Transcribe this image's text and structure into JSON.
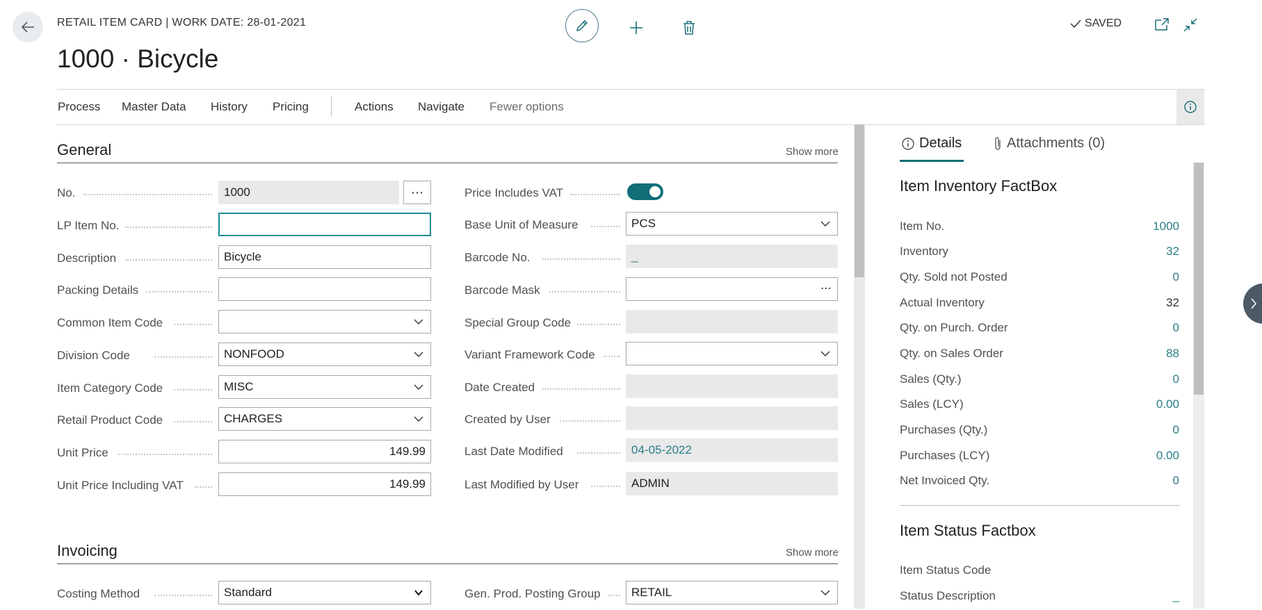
{
  "header": {
    "caption": "RETAIL ITEM CARD | WORK DATE: 28-01-2021",
    "title": "1000 · Bicycle",
    "status": "SAVED"
  },
  "actions": {
    "items": [
      "Process",
      "Master Data",
      "History",
      "Pricing",
      "Actions",
      "Navigate"
    ],
    "fewer_options": "Fewer options"
  },
  "general": {
    "title": "General",
    "show_more": "Show more",
    "left": [
      {
        "label": "No.",
        "value": "1000"
      },
      {
        "label": "LP Item No.",
        "value": ""
      },
      {
        "label": "Description",
        "value": "Bicycle"
      },
      {
        "label": "Packing Details",
        "value": ""
      },
      {
        "label": "Common Item Code",
        "value": ""
      },
      {
        "label": "Division Code",
        "value": "NONFOOD"
      },
      {
        "label": "Item Category Code",
        "value": "MISC"
      },
      {
        "label": "Retail Product Code",
        "value": "CHARGES"
      },
      {
        "label": "Unit Price",
        "value": "149.99"
      },
      {
        "label": "Unit Price Including VAT",
        "value": "149.99"
      }
    ],
    "right": [
      {
        "label": "Price Includes VAT",
        "value": "on"
      },
      {
        "label": "Base Unit of Measure",
        "value": "PCS"
      },
      {
        "label": "Barcode No.",
        "value": "_"
      },
      {
        "label": "Barcode Mask",
        "value": ""
      },
      {
        "label": "Special Group Code",
        "value": ""
      },
      {
        "label": "Variant Framework Code",
        "value": ""
      },
      {
        "label": "Date Created",
        "value": ""
      },
      {
        "label": "Created by User",
        "value": ""
      },
      {
        "label": "Last Date Modified",
        "value": "04-05-2022"
      },
      {
        "label": "Last Modified by User",
        "value": "ADMIN"
      }
    ]
  },
  "invoicing": {
    "title": "Invoicing",
    "show_more": "Show more",
    "costing_method_label": "Costing Method",
    "costing_method_value": "Standard",
    "gen_prod_label": "Gen. Prod. Posting Group",
    "gen_prod_value": "RETAIL"
  },
  "factbox": {
    "tab_details": "Details",
    "tab_attachments": "Attachments (0)",
    "inventory_title": "Item Inventory FactBox",
    "rows": [
      {
        "label": "Item No.",
        "value": "1000"
      },
      {
        "label": "Inventory",
        "value": "32"
      },
      {
        "label": "Qty. Sold not Posted",
        "value": "0"
      },
      {
        "label": "Actual Inventory",
        "value": "32"
      },
      {
        "label": "Qty. on Purch. Order",
        "value": "0"
      },
      {
        "label": "Qty. on Sales Order",
        "value": "88"
      },
      {
        "label": "Sales (Qty.)",
        "value": "0"
      },
      {
        "label": "Sales (LCY)",
        "value": "0.00"
      },
      {
        "label": "Purchases (Qty.)",
        "value": "0"
      },
      {
        "label": "Purchases (LCY)",
        "value": "0.00"
      },
      {
        "label": "Net Invoiced Qty.",
        "value": "0"
      }
    ],
    "status_title": "Item Status Factbox",
    "status_rows": [
      {
        "label": "Item Status Code",
        "value": ""
      },
      {
        "label": "Status Description",
        "value": "_"
      }
    ]
  },
  "colors": {
    "accent": "#0f6e78",
    "link": "#2a7d86"
  }
}
